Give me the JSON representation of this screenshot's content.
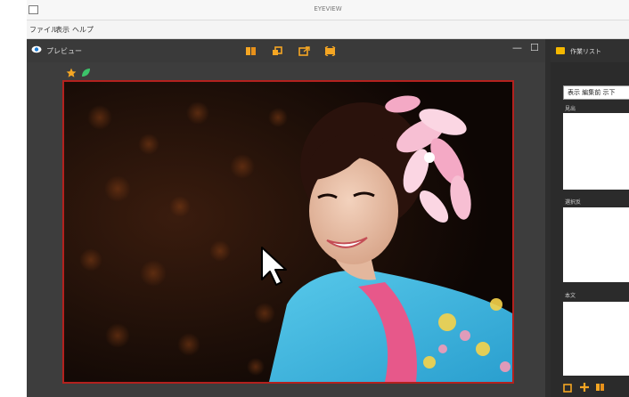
{
  "window": {
    "title": "EYEVIEW",
    "menu": [
      "ファイル",
      "表示",
      "ヘルプ"
    ]
  },
  "preview": {
    "title": "プレビュー",
    "toolbar_icons": [
      "book-icon",
      "copy-icon",
      "export-icon",
      "film-icon"
    ],
    "badges": [
      "star-icon",
      "leaf-icon"
    ]
  },
  "list_panel": {
    "title": "作業リスト",
    "selected": "表示 編集前 示下",
    "sections": [
      "見出",
      "選択反",
      "本文"
    ]
  },
  "colors": {
    "accent": "#f5a623",
    "frame_border": "#b3211e",
    "panel_dark": "#3d3d3d"
  }
}
